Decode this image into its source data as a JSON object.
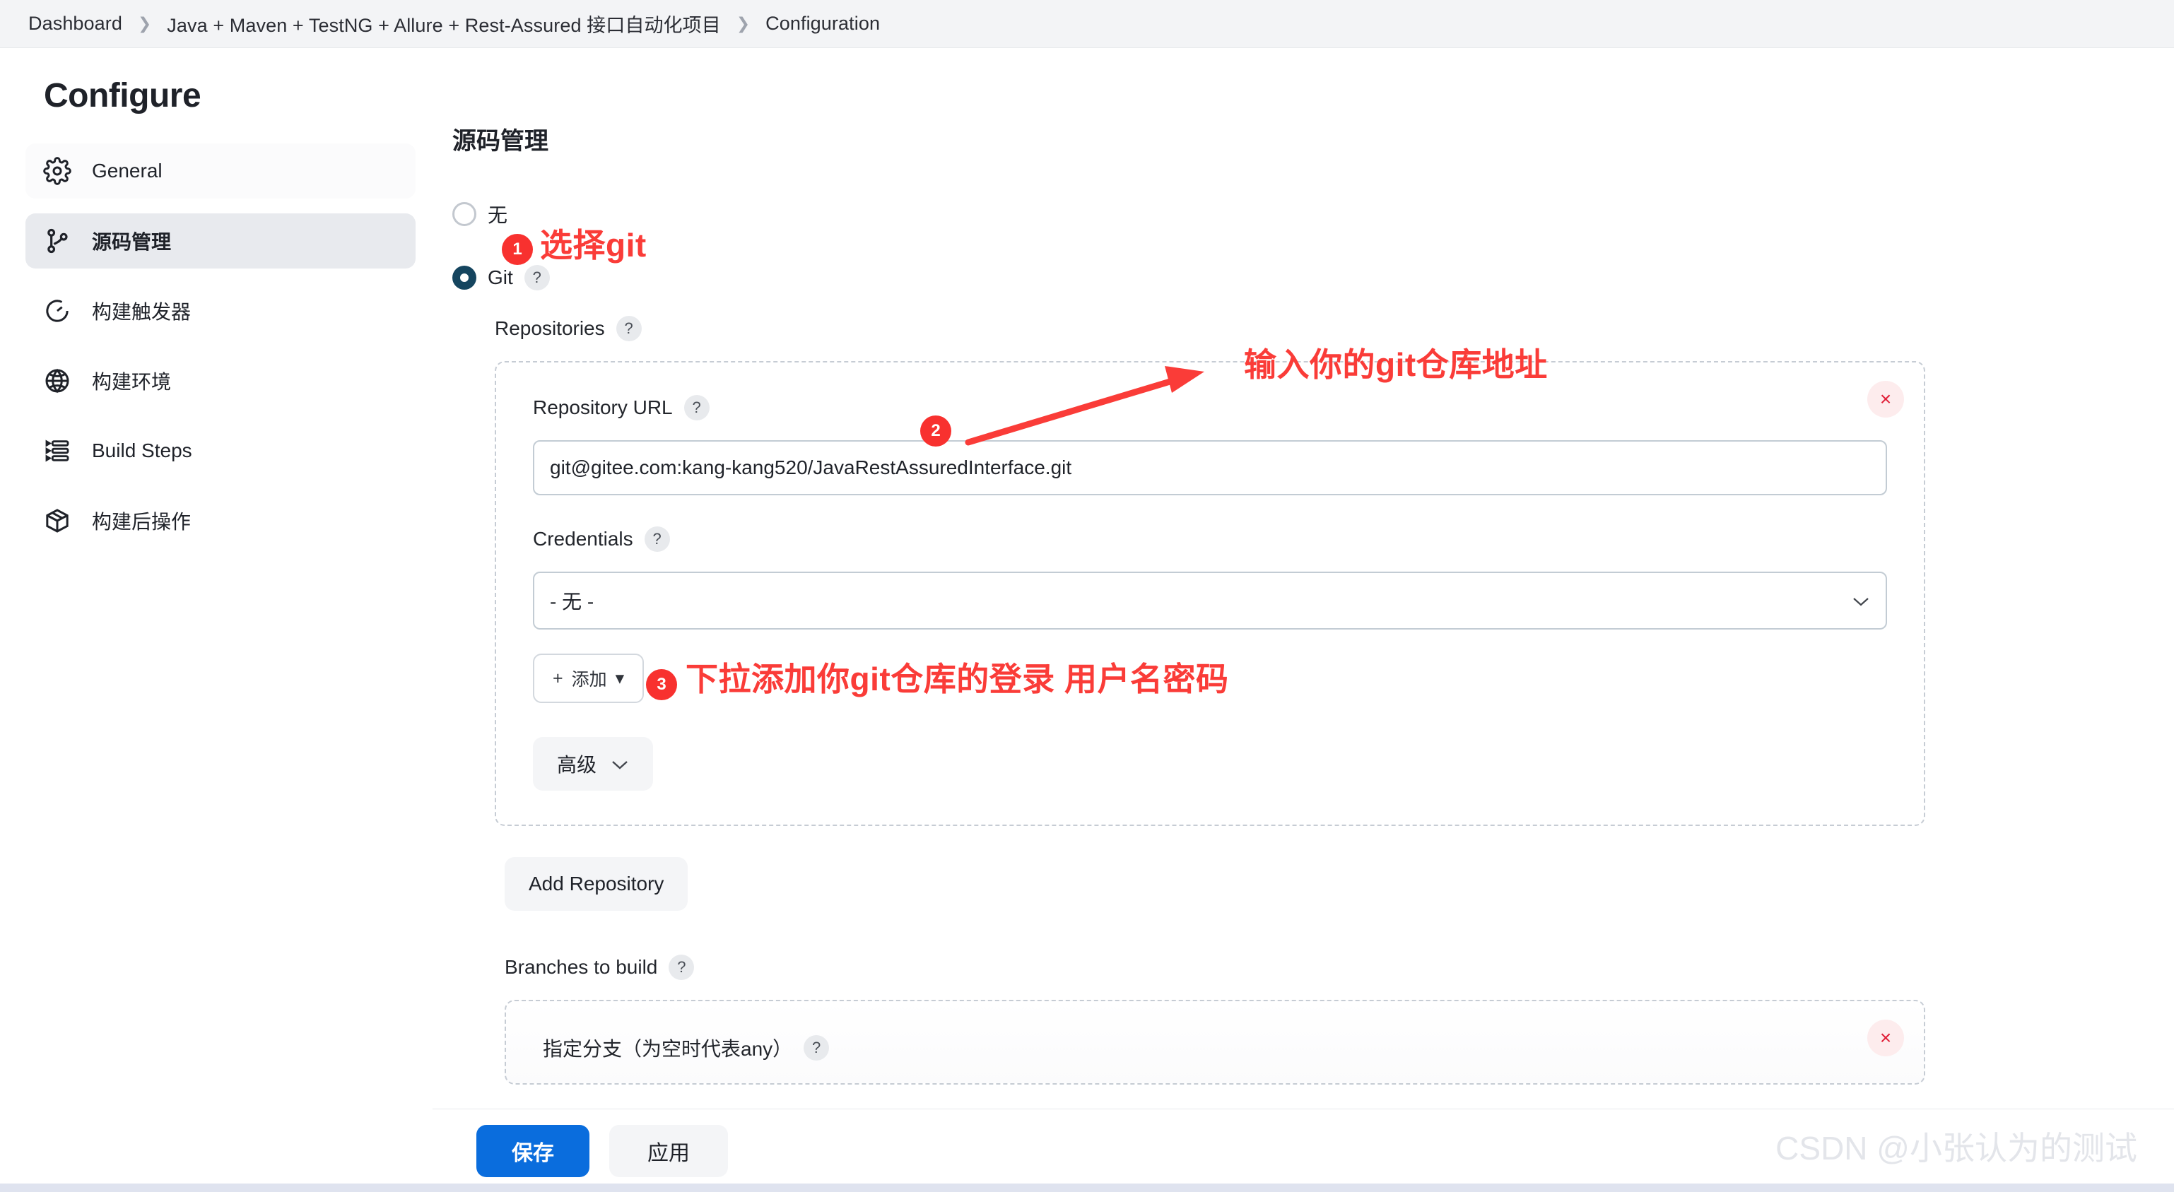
{
  "breadcrumb": {
    "items": [
      "Dashboard",
      "Java + Maven + TestNG + Allure + Rest-Assured 接口自动化项目",
      "Configuration"
    ],
    "separator": "❯"
  },
  "sidebar": {
    "title": "Configure",
    "items": [
      {
        "label": "General",
        "icon": "gear-icon",
        "selected": false
      },
      {
        "label": "源码管理",
        "icon": "git-branch-icon",
        "selected": true
      },
      {
        "label": "构建触发器",
        "icon": "clock-icon",
        "selected": false
      },
      {
        "label": "构建环境",
        "icon": "globe-icon",
        "selected": false
      },
      {
        "label": "Build Steps",
        "icon": "list-steps-icon",
        "selected": false
      },
      {
        "label": "构建后操作",
        "icon": "package-icon",
        "selected": false
      }
    ]
  },
  "main": {
    "section_title": "源码管理",
    "scm_options": [
      {
        "label": "无",
        "checked": false
      },
      {
        "label": "Git",
        "checked": true,
        "help": "?"
      }
    ],
    "repositories": {
      "label": "Repositories",
      "help": "?",
      "close_icon": "×",
      "repository_url": {
        "label": "Repository URL",
        "help": "?",
        "value": "git@gitee.com:kang-kang520/JavaRestAssuredInterface.git",
        "placeholder": ""
      },
      "credentials": {
        "label": "Credentials",
        "help": "?",
        "selected": "- 无 -",
        "chevron": "⌄"
      },
      "add_button": {
        "label": "添加",
        "plus": "+",
        "caret": "▾"
      },
      "advanced_button": {
        "label": "高级",
        "chevron": "⌄"
      }
    },
    "add_repository_button": "Add Repository",
    "branches": {
      "label": "Branches to build",
      "help": "?",
      "close_icon": "×",
      "branch_spec_label": "指定分支（为空时代表any）",
      "branch_spec_help": "?"
    }
  },
  "annotations": [
    {
      "badge": "1",
      "text": "选择git"
    },
    {
      "badge": "2",
      "text": "输入你的git仓库地址"
    },
    {
      "badge": "3",
      "text": "下拉添加你git仓库的登录 用户名密码"
    }
  ],
  "footer": {
    "save_label": "保存",
    "apply_label": "应用",
    "watermark": "CSDN @小张认为的测试"
  },
  "colors": {
    "accent_blue": "#0a6ddd",
    "radio_checked": "#15455f",
    "annotation_red": "#fa3c38",
    "badge_red": "#f8312f",
    "selected_nav_bg": "#e8eaee"
  }
}
